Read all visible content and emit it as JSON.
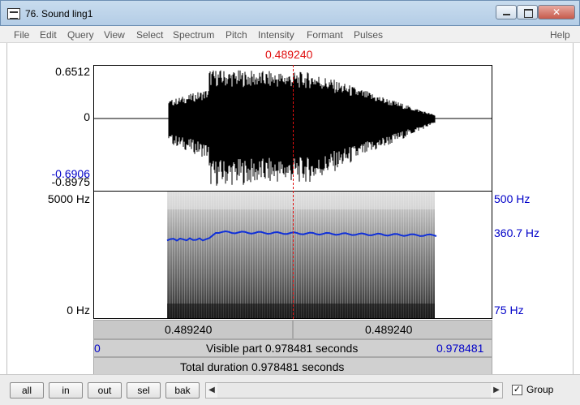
{
  "window": {
    "title": "76. Sound ling1"
  },
  "menu": [
    "File",
    "Edit",
    "Query",
    "View",
    "Select",
    "Spectrum",
    "Pitch",
    "Intensity",
    "Formant",
    "Pulses",
    "Help"
  ],
  "cursor": {
    "time": "0.489240"
  },
  "waveform": {
    "y_max": "0.6512",
    "y_zero": "0",
    "y_blue": "-0.6906",
    "y_min": "-0.8975"
  },
  "spectrogram": {
    "freq_max": "5000 Hz",
    "freq_min": "0 Hz"
  },
  "pitch": {
    "max": "500 Hz",
    "value": "360.7 Hz",
    "min": "75 Hz"
  },
  "selection": {
    "left": "0.489240",
    "right": "0.489240"
  },
  "visible": {
    "start": "0",
    "label": "Visible part 0.978481 seconds",
    "end": "0.978481"
  },
  "total": {
    "label": "Total duration 0.978481 seconds"
  },
  "buttons": {
    "all": "all",
    "in": "in",
    "out": "out",
    "sel": "sel",
    "bak": "bak"
  },
  "group": {
    "label": "Group",
    "checked": true
  },
  "colors": {
    "cursor": "#e01010",
    "pitch": "#0000c8"
  }
}
